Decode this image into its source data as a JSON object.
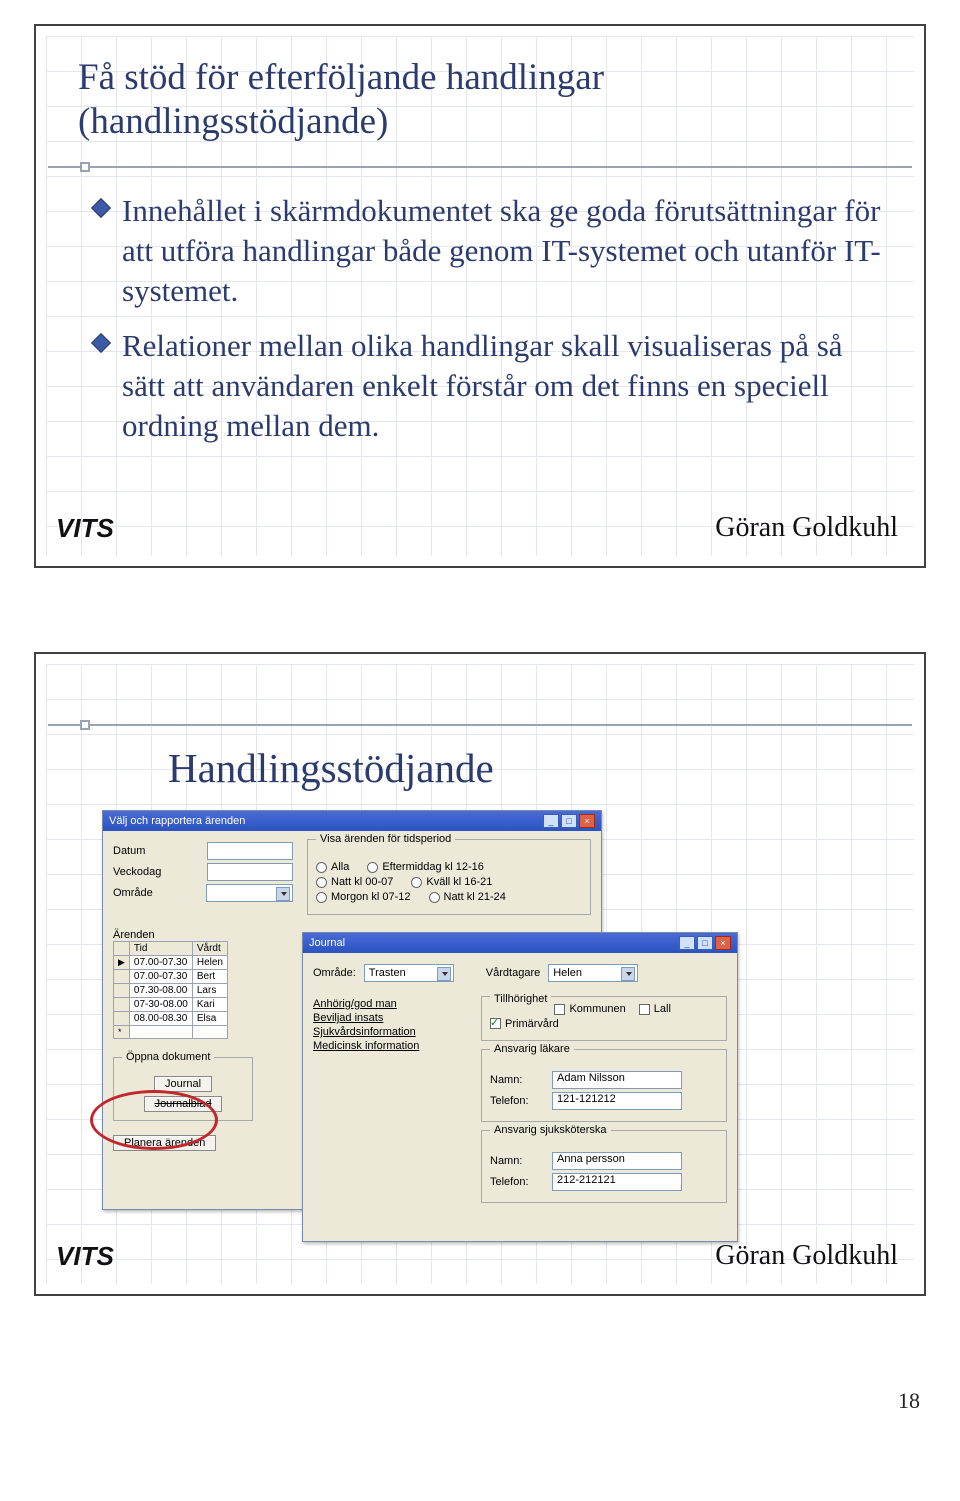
{
  "slide1": {
    "title_l1": "Få stöd för efterföljande handlingar",
    "title_l2": "(handlingsstödjande)",
    "bullet1": "Innehållet i skärmdokumentet ska ge goda förutsättningar för att utföra handlingar både genom IT-systemet och utanför IT-systemet.",
    "bullet2": "Relationer mellan olika handlingar skall visualiseras på så sätt att användaren enkelt förstår om det finns en speciell ordning mellan dem."
  },
  "footer": {
    "brand": "VITS",
    "author": "Göran Goldkuhl"
  },
  "slide2": {
    "title": "Handlingsstödjande",
    "win1": {
      "title": "Välj och rapportera ärenden",
      "labels": {
        "datum": "Datum",
        "veckodag": "Veckodag",
        "omrade": "Område",
        "arenden": "Ärenden",
        "oppna": "Öppna dokument"
      },
      "period_legend": "Visa ärenden för tidsperiod",
      "period_options": {
        "alla": "Alla",
        "natt0007": "Natt kl 00-07",
        "morgon0712": "Morgon kl 07-12",
        "em1216": "Eftermiddag kl 12-16",
        "kvall1621": "Kväll kl 16-21",
        "natt2124": "Natt kl 21-24"
      },
      "table": {
        "h_tid": "Tid",
        "h_vard": "Vårdt",
        "rows": [
          {
            "tid": "07.00-07.30",
            "v": "Helen"
          },
          {
            "tid": "07.00-07.30",
            "v": "Bert"
          },
          {
            "tid": "07.30-08.00",
            "v": "Lars"
          },
          {
            "tid": "07-30-08.00",
            "v": "Kari"
          },
          {
            "tid": "08.00-08.30",
            "v": "Elsa"
          }
        ]
      },
      "buttons": {
        "journal": "Journal",
        "journalblad": "Journalblad",
        "planera": "Planera ärenden"
      }
    },
    "win2": {
      "title": "Journal",
      "labels": {
        "omrade": "Område:",
        "vardtagare": "Vårdtagare",
        "anhorig": "Anhörig/god man",
        "beviljad": "Beviljad insats",
        "sjukinfo": "Sjukvårdsinformation",
        "medinfo": "Medicinsk information",
        "tillhor": "Tillhörighet",
        "kommunen": "Kommunen",
        "lall": "Lall",
        "primarvard": "Primärvård",
        "ansvarig_lakare": "Ansvarig läkare",
        "ansvarig_skoterska": "Ansvarig sjuksköterska",
        "namn": "Namn:",
        "telefon": "Telefon:"
      },
      "values": {
        "omrade": "Trasten",
        "vardtagare": "Helen",
        "lakare_namn": "Adam Nilsson",
        "lakare_tel": "121-121212",
        "skot_namn": "Anna persson",
        "skot_tel": "212-212121"
      }
    }
  },
  "page_number": "18"
}
